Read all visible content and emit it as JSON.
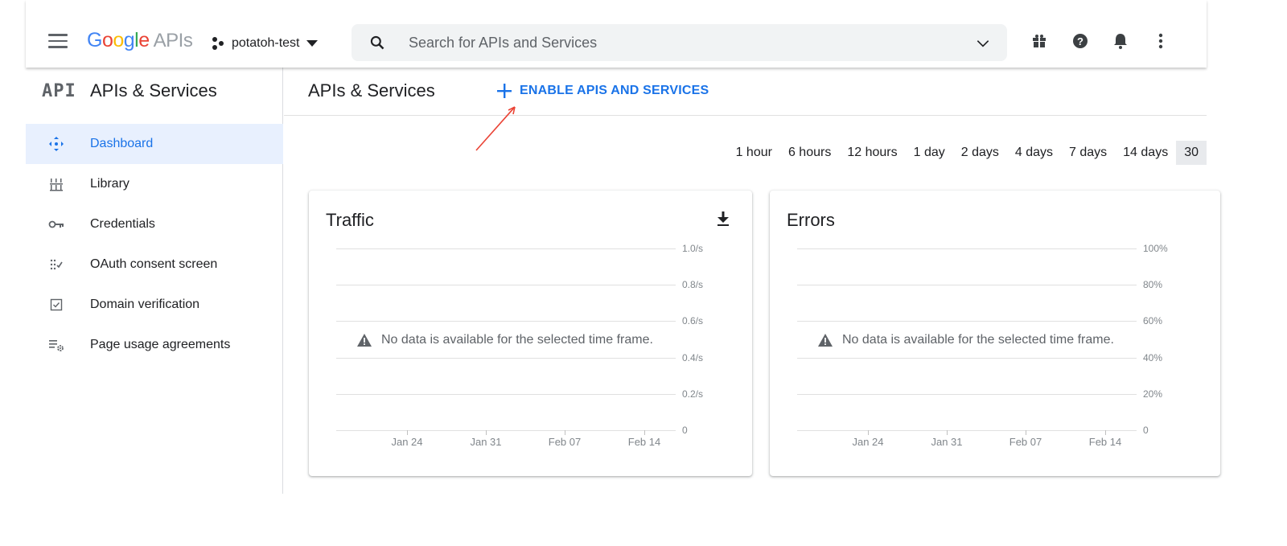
{
  "topbar": {
    "logo_brand": "Google",
    "logo_suffix": "APIs",
    "project_name": "potatoh-test",
    "search_placeholder": "Search for APIs and Services",
    "icons": [
      "menu-icon",
      "search-icon",
      "chevron-down-icon",
      "gift-icon",
      "help-icon",
      "bell-icon",
      "more-vert-icon"
    ]
  },
  "sidebar": {
    "logo": "API",
    "title": "APIs & Services",
    "items": [
      {
        "label": "Dashboard",
        "icon": "dashboard-icon",
        "active": true
      },
      {
        "label": "Library",
        "icon": "library-icon",
        "active": false
      },
      {
        "label": "Credentials",
        "icon": "key-icon",
        "active": false
      },
      {
        "label": "OAuth consent screen",
        "icon": "oauth-icon",
        "active": false
      },
      {
        "label": "Domain verification",
        "icon": "checkbox-icon",
        "active": false
      },
      {
        "label": "Page usage agreements",
        "icon": "settings-list-icon",
        "active": false
      }
    ]
  },
  "main": {
    "title": "APIs & Services",
    "enable_button": "ENABLE APIS AND SERVICES",
    "time_ranges": [
      "1 hour",
      "6 hours",
      "12 hours",
      "1 day",
      "2 days",
      "4 days",
      "7 days",
      "14 days",
      "30"
    ],
    "selected_range": "30"
  },
  "colors": {
    "accent": "#1a73e8",
    "annotation_arrow": "#ea4335",
    "active_nav_bg": "#e8f0fe"
  },
  "chart_data": [
    {
      "type": "line",
      "title": "Traffic",
      "x_ticks": [
        "Jan 24",
        "Jan 31",
        "Feb 07",
        "Feb 14"
      ],
      "y_ticks": [
        "1.0/s",
        "0.8/s",
        "0.6/s",
        "0.4/s",
        "0.2/s",
        "0"
      ],
      "series": [],
      "message": "No data is available for the selected time frame.",
      "grid": true
    },
    {
      "type": "line",
      "title": "Errors",
      "x_ticks": [
        "Jan 24",
        "Jan 31",
        "Feb 07",
        "Feb 14"
      ],
      "y_ticks": [
        "100%",
        "80%",
        "60%",
        "40%",
        "20%",
        "0"
      ],
      "series": [],
      "message": "No data is available for the selected time frame.",
      "grid": true
    }
  ]
}
